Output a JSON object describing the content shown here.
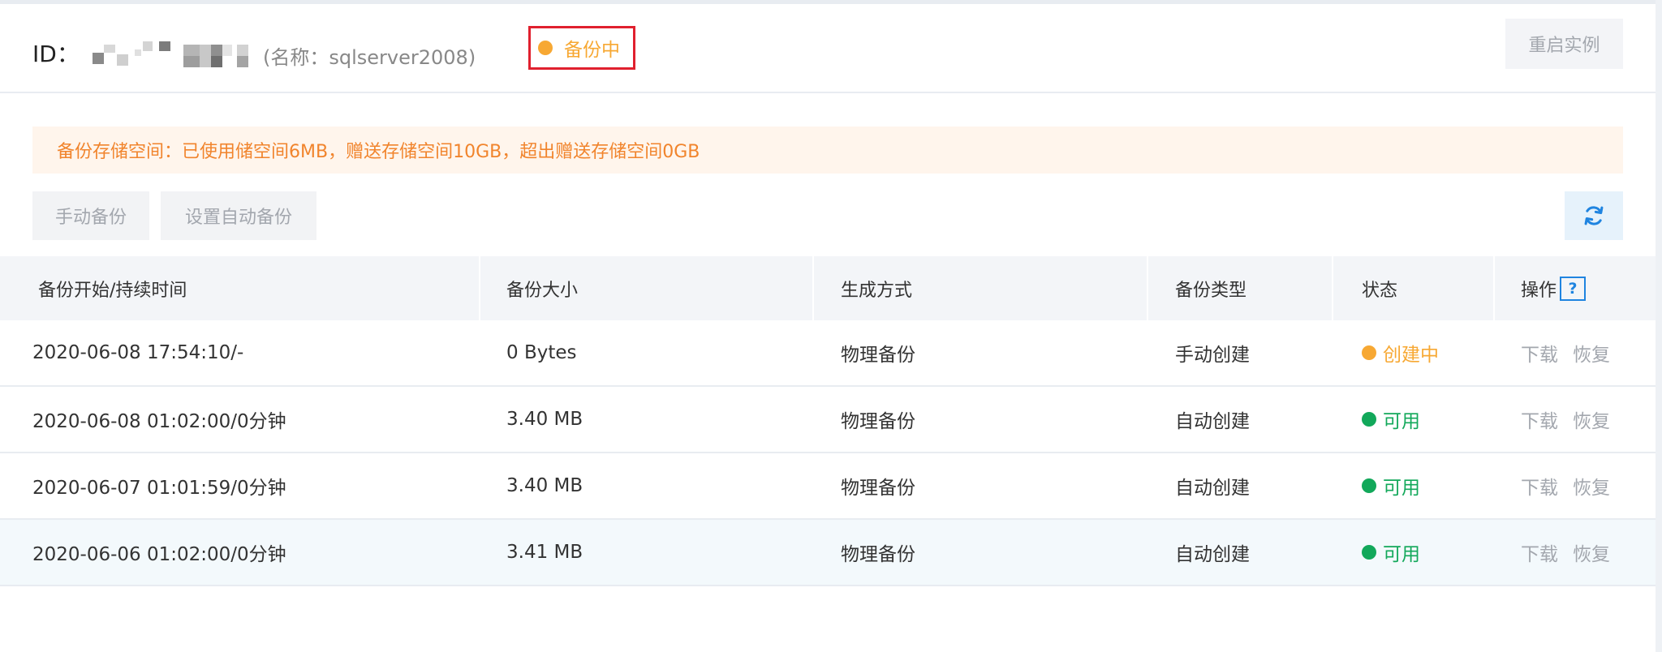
{
  "header": {
    "id_label": "ID：",
    "name_text": "(名称：sqlserver2008)",
    "status": "备份中",
    "restart_button": "重启实例"
  },
  "notice": "备份存储空间：已使用储空间6MB，赠送存储空间10GB，超出赠送存储空间0GB",
  "toolbar": {
    "manual_backup": "手动备份",
    "auto_backup_settings": "设置自动备份",
    "refresh_icon": "refresh-icon"
  },
  "table": {
    "columns": [
      "备份开始/持续时间",
      "备份大小",
      "生成方式",
      "备份类型",
      "状态",
      "操作"
    ],
    "help_glyph": "?",
    "rows": [
      {
        "time": "2020-06-08 17:54:10/-",
        "size": "0 Bytes",
        "method": "物理备份",
        "type": "手动创建",
        "status": "创建中",
        "status_kind": "creating",
        "download": "下载",
        "restore": "恢复"
      },
      {
        "time": "2020-06-08 01:02:00/0分钟",
        "size": "3.40 MB",
        "method": "物理备份",
        "type": "自动创建",
        "status": "可用",
        "status_kind": "ok",
        "download": "下载",
        "restore": "恢复"
      },
      {
        "time": "2020-06-07 01:01:59/0分钟",
        "size": "3.40 MB",
        "method": "物理备份",
        "type": "自动创建",
        "status": "可用",
        "status_kind": "ok",
        "download": "下载",
        "restore": "恢复"
      },
      {
        "time": "2020-06-06 01:02:00/0分钟",
        "size": "3.41 MB",
        "method": "物理备份",
        "type": "自动创建",
        "status": "可用",
        "status_kind": "ok",
        "download": "下载",
        "restore": "恢复"
      }
    ]
  },
  "colors": {
    "status_orange": "#f7a833",
    "status_green": "#12a85a",
    "alert_red_border": "#e0202e",
    "notice_text": "#f1842c",
    "accent_blue": "#1f84e0"
  }
}
